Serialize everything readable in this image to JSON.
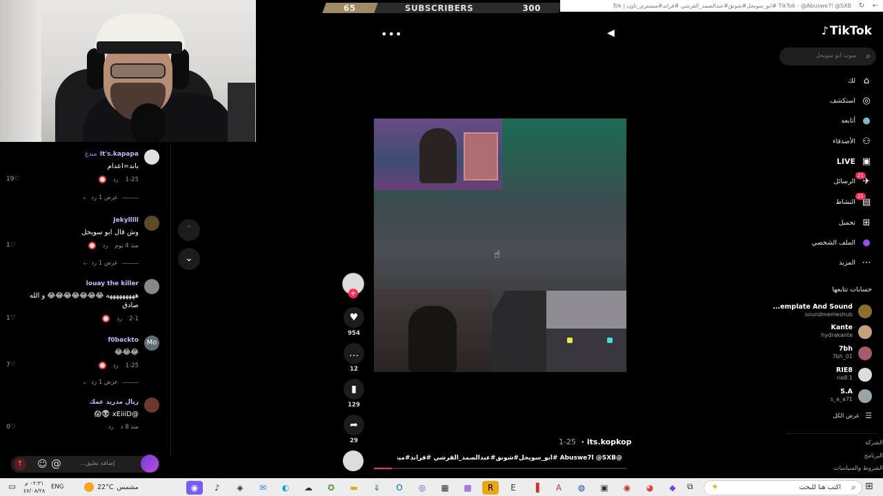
{
  "subscribers": {
    "current": "65",
    "label": "SUBSCRIBERS",
    "goal": "300",
    "progress_fraction": 0.22
  },
  "browser": {
    "title": "TikTok - @Abuswe7l @SXB #ابو_سويحل#شونق#عبدالصمد_القرشي #قراند#ميستري_تاون | TikTok"
  },
  "comments": [
    {
      "user": "It's.kapapa",
      "badge": "مبدع",
      "text": "باند=اعدام",
      "date": "1-25",
      "reply": "رد",
      "likes": "19",
      "replies_label": "عرض 1 رد"
    },
    {
      "user": "Jekylllll",
      "text": "وش قال ابو سويحل",
      "date": "منذ 4 يوم",
      "reply": "رد",
      "likes": "1",
      "replies_label": "عرض 1 رد"
    },
    {
      "user": "louay the killer",
      "text": "هههههههههه 😂😂😂😂😂😂😂 و الله صادق",
      "date": "2-1",
      "reply": "رد",
      "likes": "1"
    },
    {
      "user": "f0backto",
      "avatar_text": "Mo",
      "text": "😂😂😂",
      "date": "1-25",
      "reply": "رد",
      "likes": "7",
      "replies_label": "عرض 1 رد"
    },
    {
      "user": "ريال مدريد عمك",
      "text": "@xEiiiD 👽😱",
      "date": "منذ 8 د",
      "reply": "رد",
      "likes": "0"
    }
  ],
  "comment_input": {
    "placeholder": "إضافة تعليق..."
  },
  "video": {
    "author": "its.kopkop",
    "date": "1-25",
    "caption": "@Abuswe7l @SXB #ابو_سويحل#شونق#عبدالصمد_القرشي #قراند#ميستري_تاون",
    "likes": "954",
    "comments": "12",
    "saves": "129",
    "shares": "29",
    "progress_fraction": 0.07
  },
  "sidebar": {
    "logo": "TikTok",
    "search_placeholder": "سوت ابو سويحل",
    "nav": [
      {
        "label": "لك",
        "icon": "home-icon",
        "glyph": "⌂"
      },
      {
        "label": "استكشف",
        "icon": "compass-icon",
        "glyph": "◎"
      },
      {
        "label": "أتابعه",
        "icon": "following-avatar-icon",
        "glyph": "●"
      },
      {
        "label": "الأصدقاء",
        "icon": "friends-icon",
        "glyph": "⚇"
      },
      {
        "label": "LIVE",
        "icon": "live-icon",
        "glyph": "▣"
      },
      {
        "label": "الرسائل",
        "icon": "messages-icon",
        "glyph": "✈",
        "badge": "21"
      },
      {
        "label": "النشاط",
        "icon": "activity-icon",
        "glyph": "▤",
        "badge": "21"
      },
      {
        "label": "تحميل",
        "icon": "upload-icon",
        "glyph": "⊞"
      },
      {
        "label": "الملف الشخصي",
        "icon": "profile-avatar-icon",
        "glyph": "●"
      },
      {
        "label": "المزيد",
        "icon": "more-icon",
        "glyph": "⋯"
      }
    ],
    "following_title": "حسابات تتابعها",
    "following": [
      {
        "name": "...emplate And Sound",
        "handle": "soundmemeshub"
      },
      {
        "name": "Kante",
        "handle": "hydrakante"
      },
      {
        "name": "7bh",
        "handle": "7bh_01"
      },
      {
        "name": "RIE8",
        "handle": "rie8.1"
      },
      {
        "name": "S.A",
        "handle": "s_a_a71"
      }
    ],
    "see_all": "عرض الكل",
    "footer": [
      "الشركة",
      "البرنامج",
      "الشروط والسياسات"
    ]
  },
  "taskbar": {
    "search_placeholder": "اكتب هنا للبحث",
    "weather_temp": "22°C",
    "weather_text": "مشمس",
    "lang": "ENG",
    "time": "٠٢:٣١ م",
    "date": "٤٧/٠٨/٢٨"
  },
  "colors": {
    "accent": "#fe2c55",
    "background": "#000000",
    "subbar_fill": "#a08a63"
  }
}
